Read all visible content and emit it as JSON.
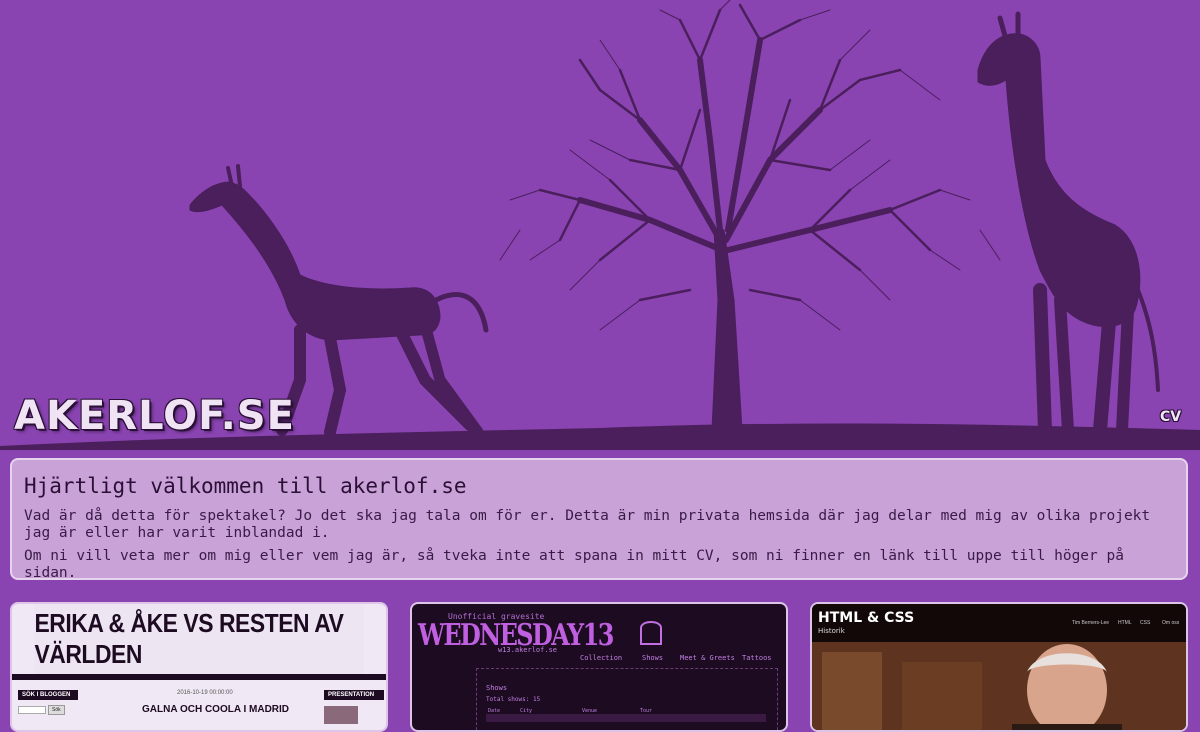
{
  "header": {
    "logo_text": "AKERLOF.SE",
    "cv_link": "CV"
  },
  "welcome": {
    "title": "Hjärtligt välkommen till akerlof.se",
    "paragraph1": "Vad är då detta för spektakel? Jo det ska jag tala om för er. Detta är min privata hemsida där jag delar med mig av olika projekt jag är eller har varit inblandad i.",
    "paragraph2": "Om ni vill veta mer om mig eller vem jag är, så tveka inte att spana in mitt CV, som ni finner en länk till uppe till höger på sidan."
  },
  "projects": [
    {
      "title": "ERIKA & ÅKE VS RESTEN AV VÄRLDEN",
      "sidebar_left": "SÖK I BLOGGEN",
      "search_button": "Sök",
      "sidebar_right": "PRESENTATION",
      "post_date": "2016-10-19 00:00:00",
      "post_title": "GALNA OCH COOLA I MADRID"
    },
    {
      "subtitle": "Unofficial gravesite",
      "logo": "WEDNESDAY13",
      "url": "w13.akerlof.se",
      "nav": [
        "Collection",
        "Shows",
        "Meet & Greets",
        "Tattoos"
      ],
      "section": "Shows",
      "total": "Total shows: 15",
      "columns": [
        "Date",
        "City",
        "Venue",
        "Tour"
      ]
    },
    {
      "title": "HTML & CSS",
      "subtitle": "Historik",
      "nav": [
        "Tim Berners-Lee",
        "HTML",
        "CSS",
        "Om oss"
      ]
    }
  ],
  "colors": {
    "background": "#8a44b2",
    "silhouette": "#4a1f5c",
    "panel": "#c9a3d8",
    "text": "#3a1a47"
  }
}
